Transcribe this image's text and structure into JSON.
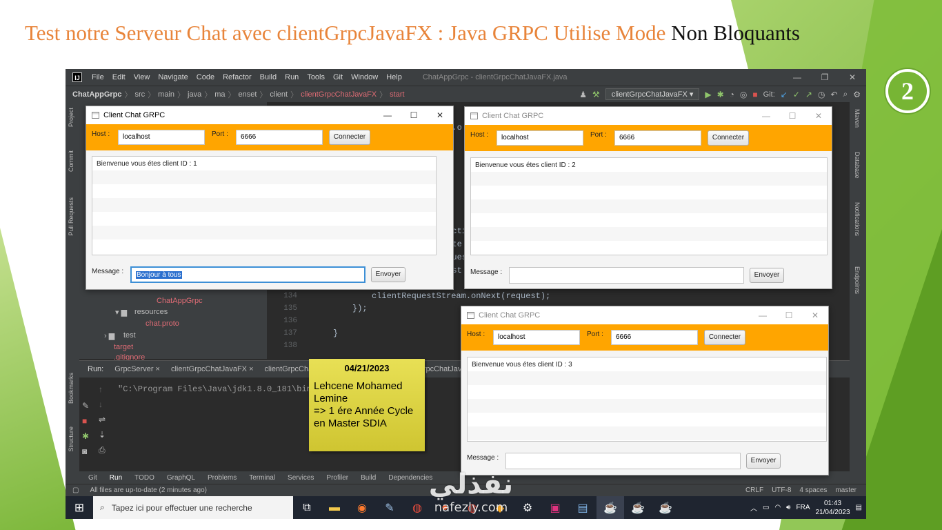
{
  "slide": {
    "title_main": "Test notre Serveur Chat avec clientGrpcJavaFX : Java GRPC Utilise Mode ",
    "title_tail": "Non Bloquants",
    "number": "2"
  },
  "ide": {
    "logo": "IJ",
    "menu": [
      "File",
      "Edit",
      "View",
      "Navigate",
      "Code",
      "Refactor",
      "Build",
      "Run",
      "Tools",
      "Git",
      "Window",
      "Help"
    ],
    "window_title": "ChatAppGrpc - clientGrpcChatJavaFX.java",
    "window_controls": [
      "—",
      "❐",
      "✕"
    ],
    "breadcrumb": [
      "ChatAppGrpc",
      "src",
      "main",
      "java",
      "ma",
      "enset",
      "client",
      "clientGrpcChatJavaFX",
      "start"
    ],
    "run_config": "clientGrpcChatJavaFX ▾",
    "git_label": "Git:",
    "left_tabs": [
      "Project",
      "Commit",
      "Pull Requests",
      "Bookmarks",
      "Structure"
    ],
    "right_tabs": [
      "Maven",
      "Database",
      "Notifications",
      "Endpoints"
    ],
    "project_tree": [
      {
        "label": "ChatAppGrpc",
        "style": "red"
      },
      {
        "label": "resources",
        "style": "normal"
      },
      {
        "label": "chat.proto",
        "style": "red"
      },
      {
        "label": "test",
        "style": "normal"
      },
      {
        "label": "target",
        "style": "red"
      },
      {
        "label": ".gitignore",
        "style": "red"
      }
    ],
    "code": {
      "line_numbers": [
        "134",
        "135",
        "136",
        "137",
        "138"
      ],
      "fragments": [
        "em.o",
        "nActi",
        "= te",
        "eques",
        "uest",
        ");"
      ],
      "lines": [
        "clientRequestStream.onNext(request);",
        "});",
        "",
        "}",
        ""
      ]
    },
    "run_panel": {
      "label": "Run:",
      "tabs": [
        "GrpcServer ×",
        "clientGrpcChatJavaFX ×",
        "clientGrpcChatJavaFX",
        "clientGrpcChatJavaFX"
      ],
      "output": "\"C:\\Program Files\\Java\\jdk1.8.0_181\\bin\\j"
    },
    "bottom_tools": [
      "Git",
      "Run",
      "TODO",
      "GraphQL",
      "Problems",
      "Terminal",
      "Services",
      "Profiler",
      "Build",
      "Dependencies"
    ],
    "status_text": "All files are up-to-date (2 minutes ago)",
    "status_right": [
      "CRLF",
      "UTF-8",
      "4 spaces",
      "master"
    ]
  },
  "taskbar": {
    "search_placeholder": "Tapez ici pour effectuer une recherche",
    "lang": "FRA",
    "time": "01:43",
    "date": "21/04/2023"
  },
  "chat_windows": [
    {
      "title": "Client Chat GRPC",
      "host_label": "Host :",
      "host_value": "localhost",
      "port_label": "Port :",
      "port_value": "6666",
      "connect_label": "Connecter",
      "messages": [
        "Bienvenue vous étes client ID : 1"
      ],
      "message_label": "Message :",
      "message_value": "Bonjour à tous",
      "send_label": "Envoyer"
    },
    {
      "title": "Client Chat GRPC",
      "host_label": "Host :",
      "host_value": "localhost",
      "port_label": "Port :",
      "port_value": "6666",
      "connect_label": "Connecter",
      "messages": [
        "Bienvenue vous étes client ID : 2"
      ],
      "message_label": "Message :",
      "message_value": "",
      "send_label": "Envoyer"
    },
    {
      "title": "Client Chat GRPC",
      "host_label": "Host :",
      "host_value": "localhost",
      "port_label": "Port :",
      "port_value": "6666",
      "connect_label": "Connecter",
      "messages": [
        "Bienvenue vous étes client ID : 3"
      ],
      "message_label": "Message :",
      "message_value": "",
      "send_label": "Envoyer"
    }
  ],
  "sticky_note": {
    "date": "04/21/2023",
    "lines": [
      "Lehcene Mohamed",
      "Lemine",
      "=> 1 ére Année Cycle",
      "en Master SDIA"
    ]
  },
  "watermark": {
    "arabic": "نفذلي",
    "latin": "nafezly.com"
  },
  "colors": {
    "title_orange": "#e8843a",
    "chat_bar": "#ffa500",
    "accent_green": "#77b534"
  }
}
